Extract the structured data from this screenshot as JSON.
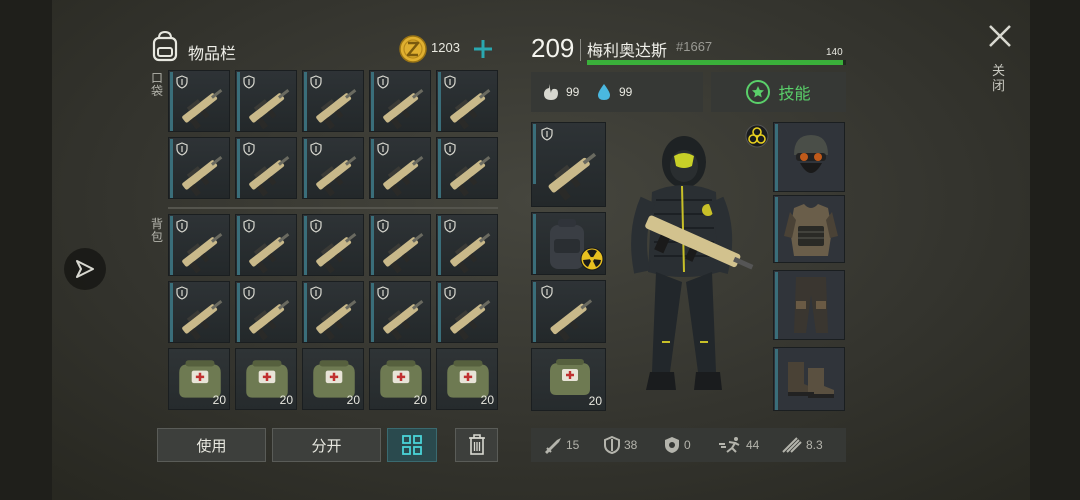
{
  "inventory": {
    "title": "物品栏",
    "coins": "1203",
    "pocket_label": "口袋",
    "backpack_label": "背包",
    "med_qty": [
      "20",
      "20",
      "20",
      "20",
      "20"
    ]
  },
  "actions": {
    "use_label": "使用",
    "split_label": "分开"
  },
  "player": {
    "level": "209",
    "name": "梅利奥达斯",
    "id": "#1667",
    "xp": "140",
    "xp_fraction": 0.99,
    "food": "99",
    "water": "99",
    "skills_label": "技能",
    "equip_med_qty": "20"
  },
  "stats": {
    "attack": "15",
    "armor": "38",
    "radiation": "0",
    "speed": "44",
    "stealth": "8.3"
  },
  "window": {
    "close_label": "关闭"
  },
  "colors": {
    "accent_green": "#3ab03a",
    "skill_green": "#5ad06a",
    "slot_marker": "#3a6e7a",
    "coin_gold": "#e0b030"
  }
}
